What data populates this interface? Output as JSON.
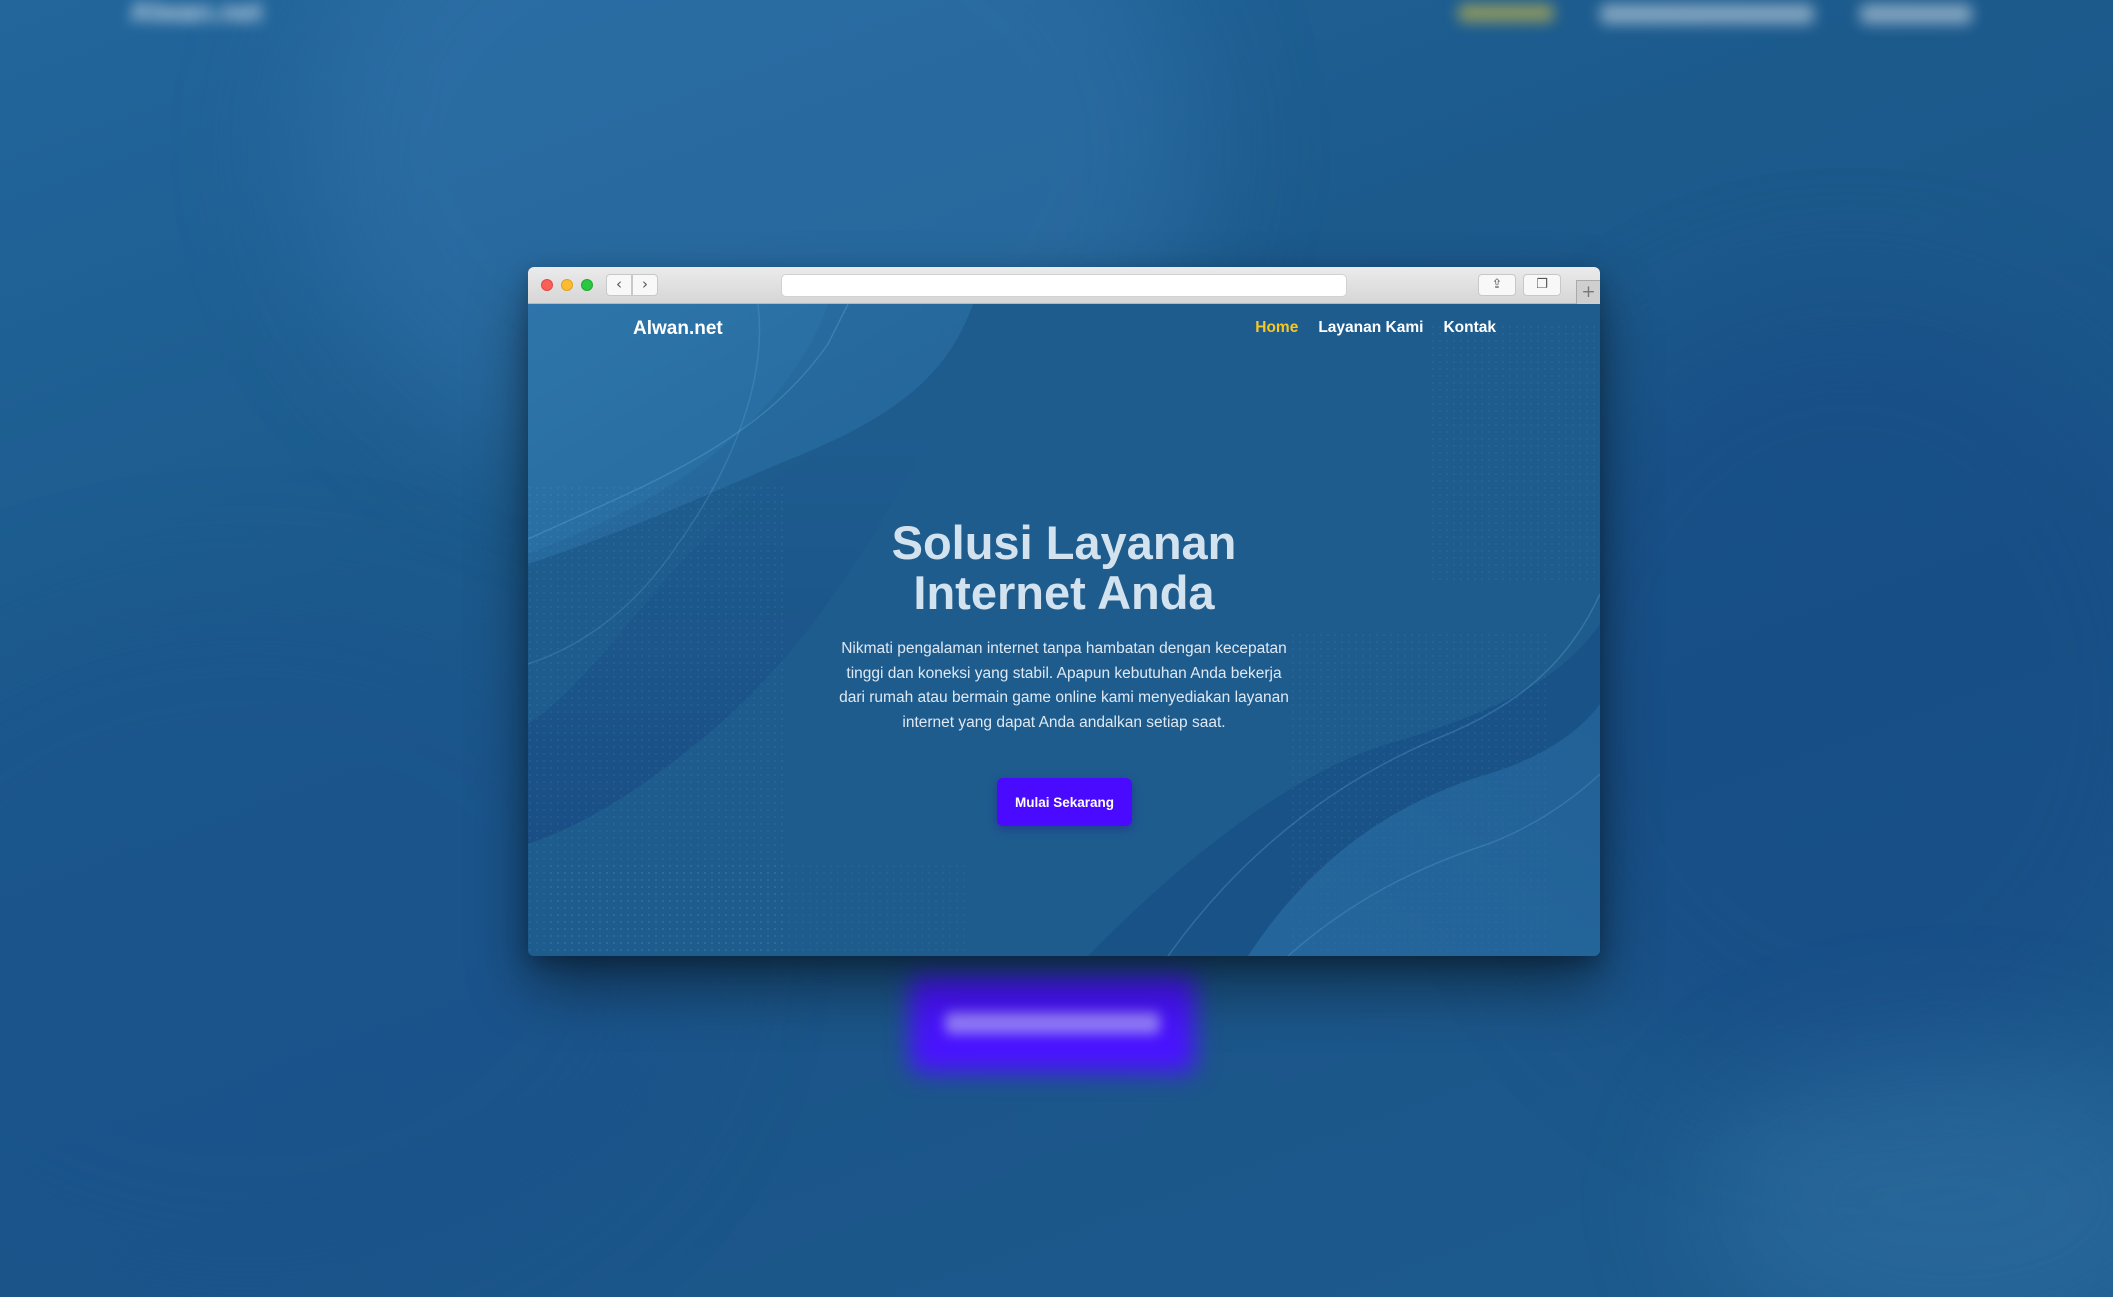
{
  "backdrop": {
    "ghost_logo": "Alwan.net"
  },
  "browser": {
    "back_glyph": "‹",
    "forward_glyph": "›",
    "share_glyph": "⇪",
    "tabs_glyph": "❐",
    "newtab_glyph": "+",
    "address": ""
  },
  "site": {
    "logo": "Alwan.net",
    "nav": {
      "home": "Home",
      "services": "Layanan Kami",
      "contact": "Kontak"
    },
    "hero": {
      "title_line1": "Solusi Layanan",
      "title_line2": "Internet Anda",
      "description": "Nikmati pengalaman internet tanpa hambatan dengan kecepatan tinggi dan koneksi yang stabil. Apapun kebutuhan Anda bekerja dari rumah atau bermain game online kami menyediakan layanan internet yang dapat Anda andalkan setiap saat.",
      "cta_label": "Mulai Sekarang"
    }
  },
  "colors": {
    "page_background": "#1e5c8e",
    "nav_active": "#f6c824",
    "cta_background": "#4a0aff",
    "title_text": "#d3e2ef"
  },
  "icons": {
    "window_controls": [
      "close-light-icon",
      "minimize-light-icon",
      "zoom-light-icon"
    ],
    "toolbar": [
      "chevron-left-icon",
      "chevron-right-icon",
      "share-icon",
      "tabs-icon",
      "plus-icon"
    ]
  }
}
